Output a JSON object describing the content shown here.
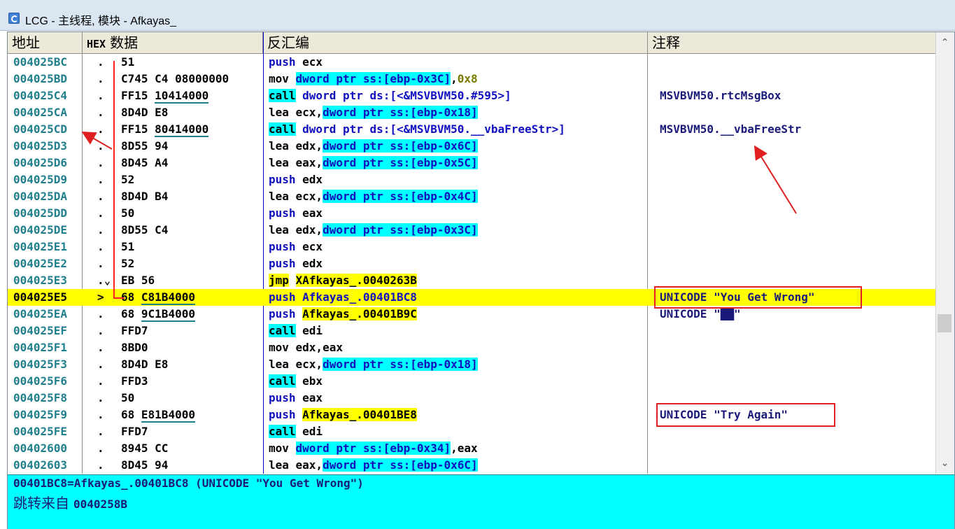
{
  "window": {
    "title": "LCG - 主线程, 模块 - Afkayas_"
  },
  "columns": {
    "address": "地址",
    "hex_prefix": "HEX",
    "hex": "数据",
    "disasm": "反汇编",
    "comment": "注释"
  },
  "rows": [
    {
      "addr": "004025BC",
      "flag": ".",
      "hex": "51",
      "asm": [
        {
          "t": "push",
          "c": "kw"
        },
        {
          "t": " ecx"
        }
      ]
    },
    {
      "addr": "004025BD",
      "flag": ".",
      "hex": "C745 C4 08000000",
      "asm": [
        {
          "t": "mov "
        },
        {
          "t": "dword ptr ss:[ebp-0x3C]",
          "c": "mem"
        },
        {
          "t": ","
        },
        {
          "t": "0x8",
          "c": "num"
        }
      ]
    },
    {
      "addr": "004025C4",
      "flag": ".",
      "hex_parts": [
        {
          "t": "FF15 "
        },
        {
          "t": "10414000",
          "c": "u"
        }
      ],
      "asm": [
        {
          "t": "call",
          "c": "kwc"
        },
        {
          "t": " dword ptr ds:[<&MSVBVM50.#595>]",
          "c": "kw"
        }
      ],
      "comment": "MSVBVM50.rtcMsgBox"
    },
    {
      "addr": "004025CA",
      "flag": ".",
      "hex": "8D4D E8",
      "asm": [
        {
          "t": "lea ecx,"
        },
        {
          "t": "dword ptr ss:[ebp-0x18]",
          "c": "mem"
        }
      ]
    },
    {
      "addr": "004025CD",
      "flag": ".",
      "hex_parts": [
        {
          "t": "FF15 "
        },
        {
          "t": "80414000",
          "c": "u"
        }
      ],
      "asm": [
        {
          "t": "call",
          "c": "kwc"
        },
        {
          "t": " dword ptr ds:[<&MSVBVM50.__vbaFreeStr>]",
          "c": "kw"
        }
      ],
      "comment": "MSVBVM50.__vbaFreeStr"
    },
    {
      "addr": "004025D3",
      "flag": ".",
      "hex": "8D55 94",
      "asm": [
        {
          "t": "lea edx,"
        },
        {
          "t": "dword ptr ss:[ebp-0x6C]",
          "c": "mem"
        }
      ]
    },
    {
      "addr": "004025D6",
      "flag": ".",
      "hex": "8D45 A4",
      "asm": [
        {
          "t": "lea eax,"
        },
        {
          "t": "dword ptr ss:[ebp-0x5C]",
          "c": "mem"
        }
      ]
    },
    {
      "addr": "004025D9",
      "flag": ".",
      "hex": "52",
      "asm": [
        {
          "t": "push",
          "c": "kw"
        },
        {
          "t": " edx"
        }
      ]
    },
    {
      "addr": "004025DA",
      "flag": ".",
      "hex": "8D4D B4",
      "asm": [
        {
          "t": "lea ecx,"
        },
        {
          "t": "dword ptr ss:[ebp-0x4C]",
          "c": "mem"
        }
      ]
    },
    {
      "addr": "004025DD",
      "flag": ".",
      "hex": "50",
      "asm": [
        {
          "t": "push",
          "c": "kw"
        },
        {
          "t": " eax"
        }
      ]
    },
    {
      "addr": "004025DE",
      "flag": ".",
      "hex": "8D55 C4",
      "asm": [
        {
          "t": "lea edx,"
        },
        {
          "t": "dword ptr ss:[ebp-0x3C]",
          "c": "mem"
        }
      ]
    },
    {
      "addr": "004025E1",
      "flag": ".",
      "hex": "51",
      "asm": [
        {
          "t": "push",
          "c": "kw"
        },
        {
          "t": " ecx"
        }
      ]
    },
    {
      "addr": "004025E2",
      "flag": ".",
      "hex": "52",
      "asm": [
        {
          "t": "push",
          "c": "kw"
        },
        {
          "t": " edx"
        }
      ]
    },
    {
      "addr": "004025E3",
      "flag": ".⌄",
      "hex": "EB 56",
      "asm": [
        {
          "t": "jmp",
          "c": "addr-hl"
        },
        {
          "t": " "
        },
        {
          "t": "XAfkayas_.0040263B",
          "c": "addr-hl"
        }
      ]
    },
    {
      "addr": "004025E5",
      "flag": ">",
      "hex_parts": [
        {
          "t": "68 "
        },
        {
          "t": "C81B4000",
          "c": "u"
        }
      ],
      "asm": [
        {
          "t": "push",
          "c": "kw"
        },
        {
          "t": " Afkayas_.00401BC8",
          "c": "kw"
        }
      ],
      "comment": "UNICODE \"You Get Wrong\"",
      "selected": true
    },
    {
      "addr": "004025EA",
      "flag": ".",
      "hex_parts": [
        {
          "t": "68 "
        },
        {
          "t": "9C1B4000",
          "c": "u"
        }
      ],
      "asm": [
        {
          "t": "push",
          "c": "kw"
        },
        {
          "t": " "
        },
        {
          "t": "Afkayas_.00401B9C",
          "c": "addr-hl"
        }
      ],
      "comment": "UNICODE \"██\""
    },
    {
      "addr": "004025EF",
      "flag": ".",
      "hex": "FFD7",
      "asm": [
        {
          "t": "call",
          "c": "kwc"
        },
        {
          "t": " edi"
        }
      ]
    },
    {
      "addr": "004025F1",
      "flag": ".",
      "hex": "8BD0",
      "asm": [
        {
          "t": "mov edx,eax"
        }
      ]
    },
    {
      "addr": "004025F3",
      "flag": ".",
      "hex": "8D4D E8",
      "asm": [
        {
          "t": "lea ecx,"
        },
        {
          "t": "dword ptr ss:[ebp-0x18]",
          "c": "mem"
        }
      ]
    },
    {
      "addr": "004025F6",
      "flag": ".",
      "hex": "FFD3",
      "asm": [
        {
          "t": "call",
          "c": "kwc"
        },
        {
          "t": " ebx"
        }
      ]
    },
    {
      "addr": "004025F8",
      "flag": ".",
      "hex": "50",
      "asm": [
        {
          "t": "push",
          "c": "kw"
        },
        {
          "t": " eax"
        }
      ]
    },
    {
      "addr": "004025F9",
      "flag": ".",
      "hex_parts": [
        {
          "t": "68 "
        },
        {
          "t": "E81B4000",
          "c": "u"
        }
      ],
      "asm": [
        {
          "t": "push",
          "c": "kw"
        },
        {
          "t": " "
        },
        {
          "t": "Afkayas_.00401BE8",
          "c": "addr-hl"
        }
      ],
      "comment": "UNICODE \"Try Again\""
    },
    {
      "addr": "004025FE",
      "flag": ".",
      "hex": "FFD7",
      "asm": [
        {
          "t": "call",
          "c": "kwc"
        },
        {
          "t": " edi"
        }
      ]
    },
    {
      "addr": "00402600",
      "flag": ".",
      "hex": "8945 CC",
      "asm": [
        {
          "t": "mov "
        },
        {
          "t": "dword ptr ss:[ebp-0x34]",
          "c": "mem"
        },
        {
          "t": ",eax"
        }
      ]
    },
    {
      "addr": "00402603",
      "flag": ".",
      "hex": "8D45 94",
      "asm": [
        {
          "t": "lea eax,"
        },
        {
          "t": "dword ptr ss:[ebp-0x6C]",
          "c": "mem"
        }
      ]
    }
  ],
  "info": {
    "line1": "00401BC8=Afkayas_.00401BC8 (UNICODE \"You Get Wrong\")",
    "jump_label": "跳转来自",
    "jump_addr": "0040258B"
  },
  "icons": {
    "app": "app-icon",
    "scroll_up": "chevron-up-icon",
    "scroll_down": "chevron-down-icon"
  },
  "colors": {
    "selection": "#ffff00",
    "cyan_highlight": "#00ffff",
    "annotation_red": "#e02020",
    "keyword_blue": "#1010c0",
    "address_teal": "#1f7f8c"
  }
}
